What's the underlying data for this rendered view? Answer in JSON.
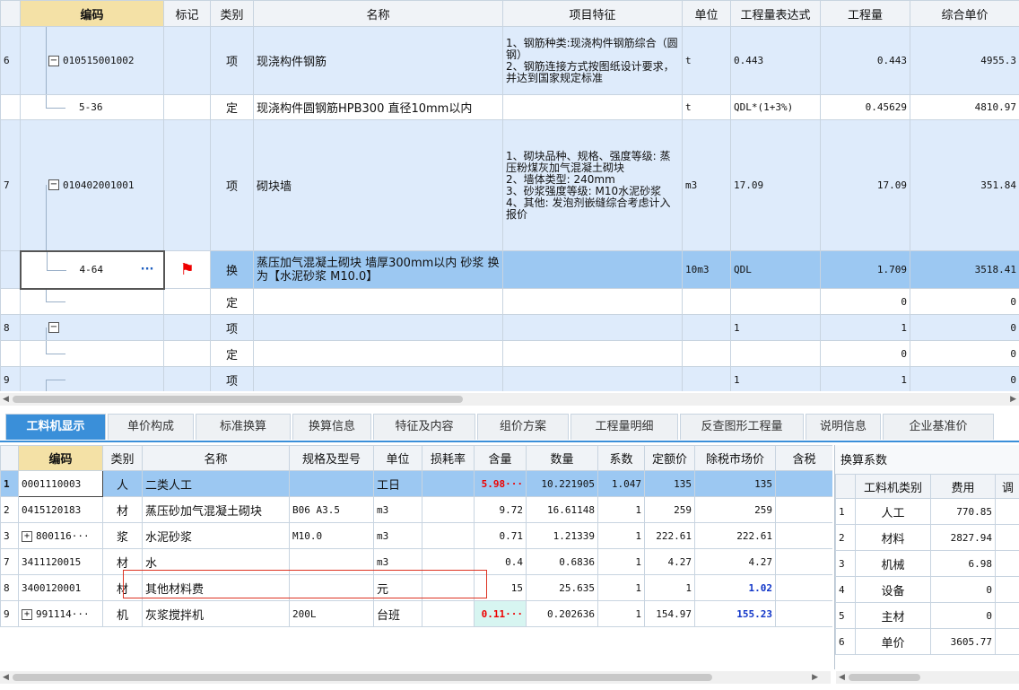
{
  "top": {
    "headers": [
      "编码",
      "标记",
      "类别",
      "名称",
      "项目特征",
      "单位",
      "工程量表达式",
      "工程量",
      "综合单价"
    ],
    "rows": [
      {
        "num": "6",
        "code": "010515001002",
        "kind": "项",
        "name": "现浇构件钢筋",
        "feat": "1、钢筋种类:现浇构件钢筋综合（圆钢）\n2、钢筋连接方式按图纸设计要求，并达到国家规定标准",
        "unit": "t",
        "expr": "0.443",
        "qty": "0.443",
        "price": "4955.3"
      },
      {
        "num": "",
        "code": "5-36",
        "kind": "定",
        "name": "现浇构件圆钢筋HPB300 直径10mm以内",
        "feat": "",
        "unit": "t",
        "expr": "QDL*(1+3%)",
        "qty": "0.45629",
        "price": "4810.97"
      },
      {
        "num": "7",
        "code": "010402001001",
        "kind": "项",
        "name": "砌块墙",
        "feat": "1、砌块品种、规格、强度等级: 蒸压粉煤灰加气混凝土砌块\n2、墙体类型: 240mm\n3、砂浆强度等级: M10水泥砂浆\n4、其他: 发泡剂嵌缝综合考虑计入报价",
        "unit": "m3",
        "expr": "17.09",
        "qty": "17.09",
        "price": "351.84"
      },
      {
        "num": "",
        "code": "4-64",
        "code_more": "···",
        "kind": "换",
        "name": "蒸压加气混凝土砌块 墙厚300mm以内 砂浆  换为【水泥砂浆 M10.0】",
        "feat": "",
        "unit": "10m3",
        "expr": "QDL",
        "qty": "1.709",
        "price": "3518.41"
      },
      {
        "num": "",
        "code": "",
        "kind": "定",
        "name": "",
        "feat": "",
        "unit": "",
        "expr": "",
        "qty": "0",
        "price": "0"
      },
      {
        "num": "8",
        "code": "",
        "kind": "项",
        "name": "",
        "feat": "",
        "unit": "",
        "expr": "1",
        "qty": "1",
        "price": "0"
      },
      {
        "num": "",
        "code": "",
        "kind": "定",
        "name": "",
        "feat": "",
        "unit": "",
        "expr": "",
        "qty": "0",
        "price": "0"
      },
      {
        "num": "9",
        "code": "",
        "kind": "项",
        "name": "",
        "feat": "",
        "unit": "",
        "expr": "1",
        "qty": "1",
        "price": "0"
      }
    ],
    "toggle_minus": "−"
  },
  "tabs": [
    "工料机显示",
    "单价构成",
    "标准换算",
    "换算信息",
    "特征及内容",
    "组价方案",
    "工程量明细",
    "反查图形工程量",
    "说明信息",
    "企业基准价"
  ],
  "bottom": {
    "headers": [
      "编码",
      "类别",
      "名称",
      "规格及型号",
      "单位",
      "损耗率",
      "含量",
      "数量",
      "系数",
      "定额价",
      "除税市场价",
      "含税"
    ],
    "rows": [
      {
        "num": "1",
        "code": "0001110003",
        "kind": "人",
        "name": "二类人工",
        "spec": "",
        "unit": "工日",
        "loss": "",
        "content": "5.98···",
        "qty": "10.221905",
        "coef": "1.047",
        "base": "135",
        "market": "135"
      },
      {
        "num": "2",
        "code": "0415120183",
        "kind": "材",
        "name": "蒸压砂加气混凝土砌块",
        "spec": "B06 A3.5",
        "unit": "m3",
        "loss": "",
        "content": "9.72",
        "qty": "16.61148",
        "coef": "1",
        "base": "259",
        "market": "259"
      },
      {
        "num": "3",
        "code": "800116···",
        "kind": "浆",
        "name": "水泥砂浆",
        "spec": "M10.0",
        "unit": "m3",
        "loss": "",
        "content": "0.71",
        "qty": "1.21339",
        "coef": "1",
        "base": "222.61",
        "market": "222.61"
      },
      {
        "num": "7",
        "code": "3411120015",
        "kind": "材",
        "name": "水",
        "spec": "",
        "unit": "m3",
        "loss": "",
        "content": "0.4",
        "qty": "0.6836",
        "coef": "1",
        "base": "4.27",
        "market": "4.27"
      },
      {
        "num": "8",
        "code": "3400120001",
        "kind": "材",
        "name": "其他材料费",
        "spec": "",
        "unit": "元",
        "loss": "",
        "content": "15",
        "qty": "25.635",
        "coef": "1",
        "base": "1",
        "market": "1.02"
      },
      {
        "num": "9",
        "code": "991114···",
        "kind": "机",
        "name": "灰浆搅拌机",
        "spec": "200L",
        "unit": "台班",
        "loss": "",
        "content": "0.11···",
        "qty": "0.202636",
        "coef": "1",
        "base": "154.97",
        "market": "155.23"
      }
    ],
    "plus": "+"
  },
  "side": {
    "title": "换算系数",
    "headers": [
      "工料机类别",
      "费用",
      "调"
    ],
    "rows": [
      {
        "num": "1",
        "cat": "人工",
        "fee": "770.85"
      },
      {
        "num": "2",
        "cat": "材料",
        "fee": "2827.94"
      },
      {
        "num": "3",
        "cat": "机械",
        "fee": "6.98"
      },
      {
        "num": "4",
        "cat": "设备",
        "fee": "0"
      },
      {
        "num": "5",
        "cat": "主材",
        "fee": "0"
      },
      {
        "num": "6",
        "cat": "单价",
        "fee": "3605.77"
      }
    ]
  },
  "colors": {
    "accent": "#3a8fd9",
    "header_highlight": "#f4e1a6",
    "selection": "#9cc8f2",
    "flag": "#e00000"
  }
}
